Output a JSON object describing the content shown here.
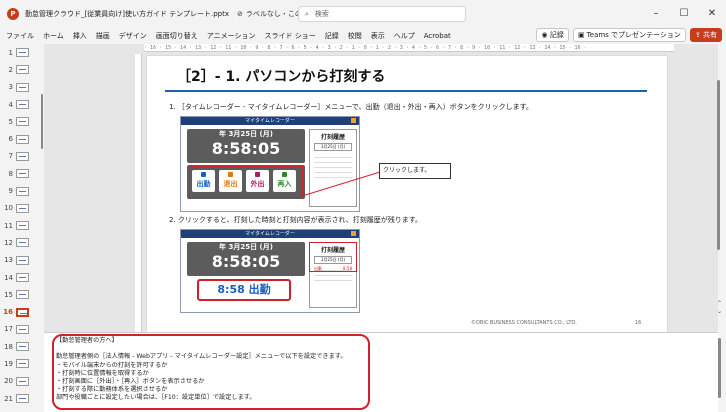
{
  "titlebar": {
    "app_icon": "P",
    "doc_title": "勤怠管理クラウド_[従業員向け]使い方ガイド テンプレート.pptx",
    "label_status": "ラベルなし・この PC に保存済み",
    "search_placeholder": "検索"
  },
  "ribbon": {
    "tabs": [
      "ファイル",
      "ホーム",
      "挿入",
      "描画",
      "デザイン",
      "画面切り替え",
      "アニメーション",
      "スライド ショー",
      "記録",
      "校閲",
      "表示",
      "ヘルプ",
      "Acrobat"
    ],
    "record_label": "記録",
    "teams_label": "Teams でプレゼンテーション",
    "share_label": "共有"
  },
  "thumbnails": {
    "numbers": [
      "1",
      "2",
      "3",
      "4",
      "5",
      "6",
      "7",
      "8",
      "9",
      "10",
      "11",
      "12",
      "13",
      "14",
      "15",
      "16",
      "17",
      "18",
      "19",
      "20",
      "21"
    ],
    "active": "16"
  },
  "ruler_text": "· 16 · 15 · 14 · 13 · 12 · 11 · 10 · 9 · 8 · 7 · 6 · 5 · 4 · 3 · 2 · 1 · 0 · 1 · 2 · 3 · 4 · 5 · 6 · 7 · 8 · 9 · 10 · 11 · 12 · 13 · 14 · 15 · 16 ·",
  "slide": {
    "title": "［2］- 1. パソコンから打刻する",
    "step1": "1. ［タイムレコーダー - マイタイムレコーダー］メニューで、出勤（退出・外出・再入）ボタンをクリックします。",
    "step2": "2. クリックすると、打刻した時刻と打刻内容が表示され、打刻履歴が残ります。",
    "app_bar": "マイタイムレコーダー",
    "date": "年 3月25日 (月)",
    "time": "8:58:05",
    "buttons": [
      "出勤",
      "退出",
      "外出",
      "再入"
    ],
    "history_title": "打刻履歴",
    "history_date": "3月25日 (月)",
    "history_entry_label": "出勤",
    "history_entry_time": "8:58",
    "callout": "クリックします。",
    "result": "8:58 出勤",
    "copyright": "©OBIC BUSINESS CONSULTANTS CO., LTD.",
    "page_number": "16"
  },
  "notes": {
    "text": "【勤怠管理者の方へ】\n\n勤怠管理者側の［法人情報 - Webアプリ - マイタイムレコーダー設定］メニューで以下を設定できます。\n・モバイル端末からの打刻を許可するか\n・打刻時に位置情報を取得するか\n・打刻画面に［外出］・［再入］ボタンを表示させるか\n・打刻する際に勤務体系を選択させるか\n部門や役職ごとに設定したい場合は、［F10：設定単位］で設定します。"
  },
  "colors": {
    "accent": "#c43e1c",
    "highlight": "#d0202a",
    "title_rule": "#1f5fb0",
    "app_bar": "#1f3f78"
  },
  "icons": [
    "app-icon",
    "tag-icon",
    "search-icon",
    "minimize-icon",
    "maximize-icon",
    "close-icon",
    "record-icon",
    "teams-icon",
    "share-icon"
  ]
}
